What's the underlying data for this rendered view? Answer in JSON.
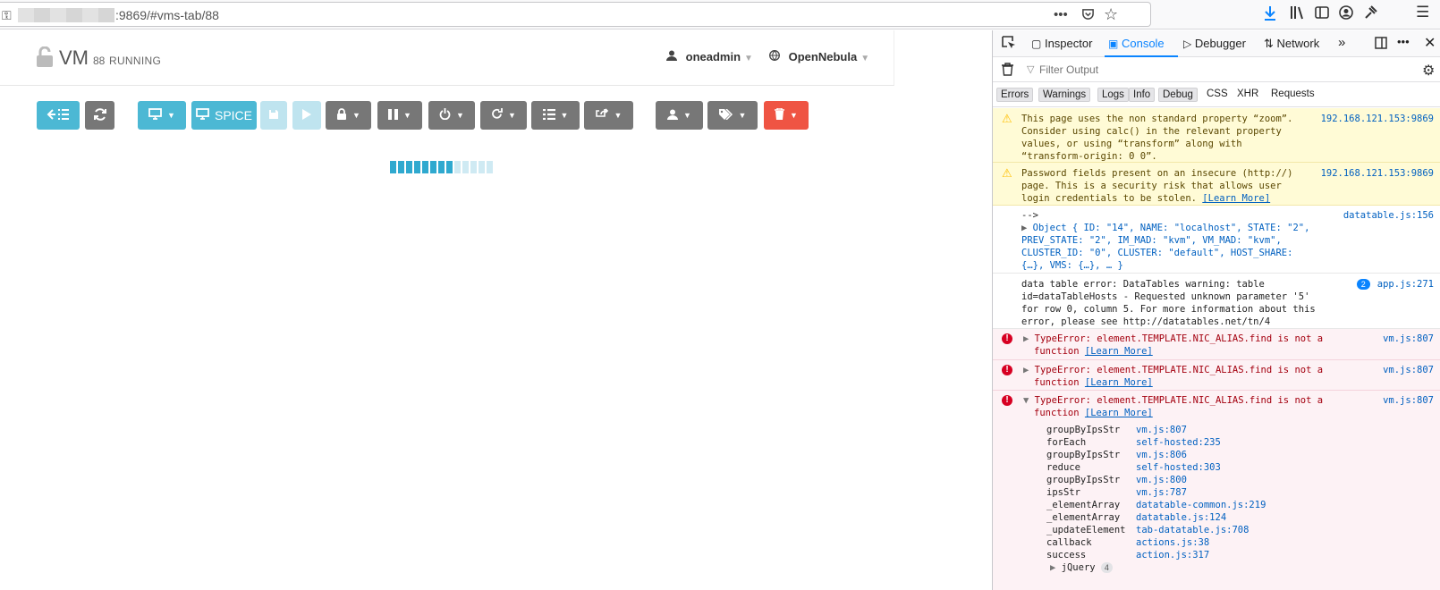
{
  "browser": {
    "url": ":9869/#vms-tab/88",
    "icons": [
      "site-info-icon",
      "page-actions-icon",
      "pocket-icon",
      "bookmark-star-icon",
      "downloads-icon",
      "library-icon",
      "sidebar-icon",
      "account-icon",
      "extension-icon",
      "menu-icon"
    ]
  },
  "header": {
    "title": "VM",
    "id": "88",
    "state": "RUNNING",
    "user": "oneadmin",
    "zone": "OpenNebula"
  },
  "toolbar": {
    "spice_label": "SPICE"
  },
  "progress": {
    "filled": 8,
    "total": 13
  },
  "devtools": {
    "tabs": [
      "Inspector",
      "Console",
      "Debugger",
      "Network"
    ],
    "active_tab": "Console",
    "filter_placeholder": "Filter Output",
    "categories": [
      "Errors",
      "Warnings",
      "Logs",
      "Info",
      "Debug",
      "CSS",
      "XHR",
      "Requests"
    ],
    "messages": {
      "warn1": {
        "lines": [
          "This page uses the non standard property “zoom”.",
          "Consider using calc() in the relevant property",
          "values, or using “transform” along with",
          "“transform-origin: 0 0”."
        ],
        "source": "192.168.121.153:9869"
      },
      "warn2": {
        "line1": "Password fields present on an insecure (http://)",
        "line2": "page. This is a security risk that allows user",
        "line3": "login credentials to be stolen.",
        "link": "[Learn More]",
        "source": "192.168.121.153:9869"
      },
      "log1": {
        "line1": "-->",
        "lines": [
          "Object { ID: \"14\", NAME: \"localhost\", STATE: \"2\",",
          "PREV_STATE: \"2\", IM_MAD: \"kvm\", VM_MAD: \"kvm\",",
          "CLUSTER_ID: \"0\", CLUSTER: \"default\", HOST_SHARE:",
          "{…}, VMS: {…}, … }"
        ],
        "source": "datatable.js:156"
      },
      "log2": {
        "lines": [
          "data table error: DataTables warning: table",
          "id=dataTableHosts - Requested unknown parameter '5'",
          "for row 0, column 5. For more information about this",
          "error, please see http://datatables.net/tn/4"
        ],
        "count": "2",
        "source": "app.js:271"
      },
      "err": {
        "line1": "TypeError: element.TEMPLATE.NIC_ALIAS.find is not a",
        "line2": "function",
        "link": "[Learn More]",
        "source": "vm.js:807"
      },
      "stack": [
        {
          "fn": "groupByIpsStr",
          "loc": "vm.js:807"
        },
        {
          "fn": "forEach",
          "loc": "self-hosted:235"
        },
        {
          "fn": "groupByIpsStr",
          "loc": "vm.js:806"
        },
        {
          "fn": "reduce",
          "loc": "self-hosted:303"
        },
        {
          "fn": "groupByIpsStr",
          "loc": "vm.js:800"
        },
        {
          "fn": "ipsStr",
          "loc": "vm.js:787"
        },
        {
          "fn": "_elementArray",
          "loc": "datatable-common.js:219"
        },
        {
          "fn": "_elementArray",
          "loc": "datatable.js:124"
        },
        {
          "fn": "_updateElement",
          "loc": "tab-datatable.js:708"
        },
        {
          "fn": "callback",
          "loc": "actions.js:38"
        },
        {
          "fn": "success",
          "loc": "action.js:317"
        }
      ],
      "jquery": {
        "label": "jQuery",
        "count": "4"
      }
    }
  }
}
